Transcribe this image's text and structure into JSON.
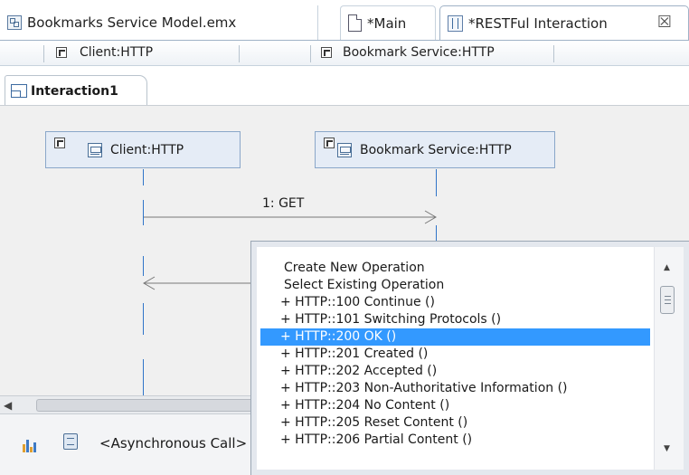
{
  "editor_tabs": [
    {
      "label": "Bookmarks Service Model.emx",
      "icon": "model-icon"
    },
    {
      "label": "*Main",
      "icon": "page-icon"
    },
    {
      "label": "*RESTFul Interaction",
      "icon": "sequence-diagram-icon",
      "close": "☒",
      "active": true
    }
  ],
  "ruler": {
    "lifelines": [
      "Client:HTTP",
      "Bookmark Service:HTTP"
    ]
  },
  "interaction_tab": {
    "label": "Interaction1"
  },
  "diagram": {
    "lifelines": [
      "Client:HTTP",
      "Bookmark Service:HTTP"
    ],
    "message_label": "1: GET"
  },
  "bottom_palette": {
    "label": "<Asynchronous Call>"
  },
  "popup": {
    "items": [
      "Create New Operation",
      "Select Existing Operation",
      "+ HTTP::100 Continue ()",
      "+ HTTP::101 Switching Protocols ()",
      "+ HTTP::200 OK ()",
      "+ HTTP::201 Created ()",
      "+ HTTP::202 Accepted ()",
      "+ HTTP::203 Non-Authoritative Information ()",
      "+ HTTP::204 No Content ()",
      "+ HTTP::205 Reset Content ()",
      "+ HTTP::206 Partial Content ()"
    ],
    "selected_index": 4
  },
  "colors": {
    "selection": "#3399ff",
    "lifeline": "#2f74c8",
    "lifeline_box": "#e5ecf6"
  }
}
